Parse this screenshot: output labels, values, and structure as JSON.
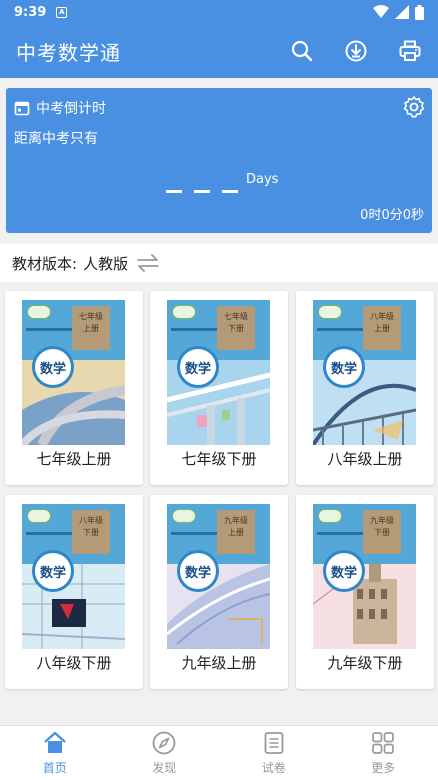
{
  "status": {
    "time": "9:39",
    "sim_letter": "A"
  },
  "app": {
    "title": "中考数学通"
  },
  "countdown": {
    "title": "中考倒计时",
    "subtitle": "距离中考只有",
    "days_label": "Days",
    "hms": "0时0分0秒"
  },
  "version": {
    "label": "教材版本:",
    "value": "人教版"
  },
  "books": [
    {
      "label": "七年级上册",
      "grade": "七年级",
      "volume": "上册",
      "cover_word": "数学",
      "scene": "road"
    },
    {
      "label": "七年级下册",
      "grade": "七年级",
      "volume": "下册",
      "cover_word": "数学",
      "scene": "bridge"
    },
    {
      "label": "八年级上册",
      "grade": "八年级",
      "volume": "上册",
      "cover_word": "数学",
      "scene": "arch"
    },
    {
      "label": "八年级下册",
      "grade": "八年级",
      "volume": "下册",
      "cover_word": "数学",
      "scene": "box"
    },
    {
      "label": "九年级上册",
      "grade": "九年级",
      "volume": "上册",
      "cover_word": "数学",
      "scene": "curve"
    },
    {
      "label": "九年级下册",
      "grade": "九年级",
      "volume": "下册",
      "cover_word": "数学",
      "scene": "building"
    }
  ],
  "nav": [
    {
      "label": "首页",
      "icon": "home-icon",
      "active": true
    },
    {
      "label": "发现",
      "icon": "compass-icon",
      "active": false
    },
    {
      "label": "试卷",
      "icon": "paper-icon",
      "active": false
    },
    {
      "label": "更多",
      "icon": "grid-icon",
      "active": false
    }
  ],
  "colors": {
    "primary": "#4a90e2",
    "background": "#f1f1f1"
  }
}
